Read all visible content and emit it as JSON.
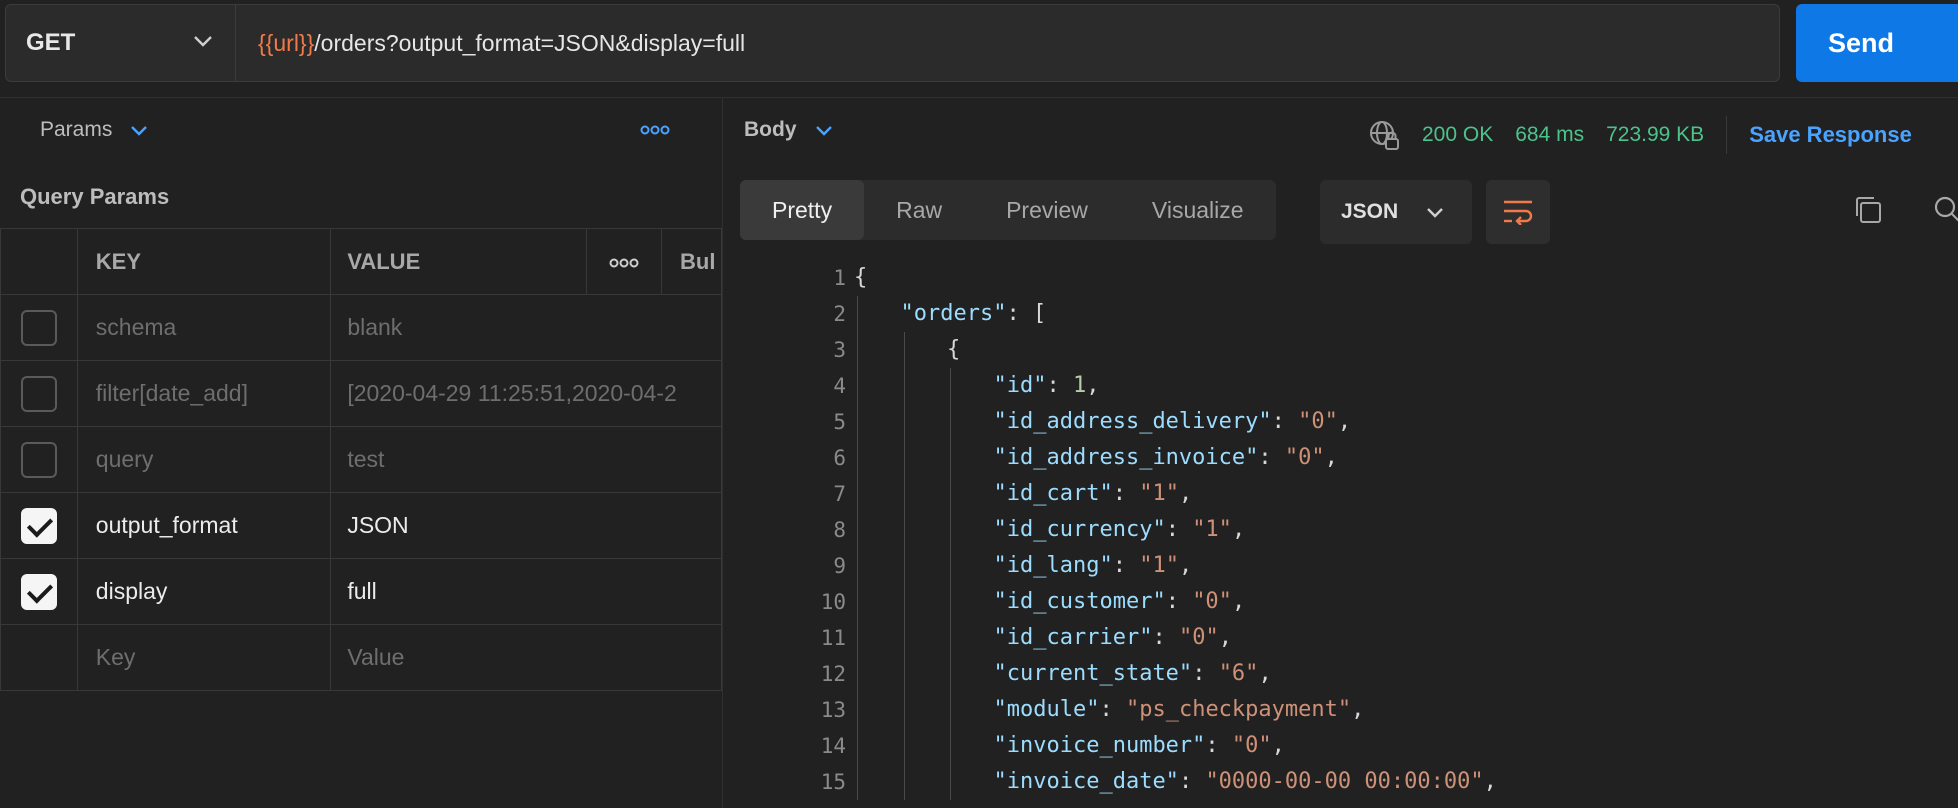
{
  "request": {
    "method": "GET",
    "url_var": "{{url}}",
    "url_path": "/orders?output_format=JSON&display=full",
    "send_label": "Send"
  },
  "params_panel": {
    "tab_label": "Params",
    "section_title": "Query Params",
    "columns": {
      "key": "KEY",
      "value": "VALUE",
      "bulk": "Bul"
    },
    "rows": [
      {
        "checked": false,
        "key": "schema",
        "value": "blank"
      },
      {
        "checked": false,
        "key": "filter[date_add]",
        "value": "[2020-04-29 11:25:51,2020-04-2"
      },
      {
        "checked": false,
        "key": "query",
        "value": "test"
      },
      {
        "checked": true,
        "key": "output_format",
        "value": "JSON"
      },
      {
        "checked": true,
        "key": "display",
        "value": "full"
      }
    ],
    "new_row": {
      "key_placeholder": "Key",
      "value_placeholder": "Value"
    }
  },
  "response": {
    "tab_label": "Body",
    "status": "200 OK",
    "time": "684 ms",
    "size": "723.99 KB",
    "save_label": "Save Response",
    "view_tabs": [
      "Pretty",
      "Raw",
      "Preview",
      "Visualize"
    ],
    "active_view": "Pretty",
    "format": "JSON",
    "lines": [
      {
        "n": "1",
        "indent": 0,
        "parts": [
          [
            "p",
            "{"
          ]
        ]
      },
      {
        "n": "2",
        "indent": 1,
        "parts": [
          [
            "k",
            "\"orders\""
          ],
          [
            "p",
            ": ["
          ]
        ]
      },
      {
        "n": "3",
        "indent": 2,
        "parts": [
          [
            "p",
            "{"
          ]
        ]
      },
      {
        "n": "4",
        "indent": 3,
        "parts": [
          [
            "k",
            "\"id\""
          ],
          [
            "p",
            ": "
          ],
          [
            "n",
            "1"
          ],
          [
            "p",
            ","
          ]
        ]
      },
      {
        "n": "5",
        "indent": 3,
        "parts": [
          [
            "k",
            "\"id_address_delivery\""
          ],
          [
            "p",
            ": "
          ],
          [
            "s",
            "\"0\""
          ],
          [
            "p",
            ","
          ]
        ]
      },
      {
        "n": "6",
        "indent": 3,
        "parts": [
          [
            "k",
            "\"id_address_invoice\""
          ],
          [
            "p",
            ": "
          ],
          [
            "s",
            "\"0\""
          ],
          [
            "p",
            ","
          ]
        ]
      },
      {
        "n": "7",
        "indent": 3,
        "parts": [
          [
            "k",
            "\"id_cart\""
          ],
          [
            "p",
            ": "
          ],
          [
            "s",
            "\"1\""
          ],
          [
            "p",
            ","
          ]
        ]
      },
      {
        "n": "8",
        "indent": 3,
        "parts": [
          [
            "k",
            "\"id_currency\""
          ],
          [
            "p",
            ": "
          ],
          [
            "s",
            "\"1\""
          ],
          [
            "p",
            ","
          ]
        ]
      },
      {
        "n": "9",
        "indent": 3,
        "parts": [
          [
            "k",
            "\"id_lang\""
          ],
          [
            "p",
            ": "
          ],
          [
            "s",
            "\"1\""
          ],
          [
            "p",
            ","
          ]
        ]
      },
      {
        "n": "10",
        "indent": 3,
        "parts": [
          [
            "k",
            "\"id_customer\""
          ],
          [
            "p",
            ": "
          ],
          [
            "s",
            "\"0\""
          ],
          [
            "p",
            ","
          ]
        ]
      },
      {
        "n": "11",
        "indent": 3,
        "parts": [
          [
            "k",
            "\"id_carrier\""
          ],
          [
            "p",
            ": "
          ],
          [
            "s",
            "\"0\""
          ],
          [
            "p",
            ","
          ]
        ]
      },
      {
        "n": "12",
        "indent": 3,
        "parts": [
          [
            "k",
            "\"current_state\""
          ],
          [
            "p",
            ": "
          ],
          [
            "s",
            "\"6\""
          ],
          [
            "p",
            ","
          ]
        ]
      },
      {
        "n": "13",
        "indent": 3,
        "parts": [
          [
            "k",
            "\"module\""
          ],
          [
            "p",
            ": "
          ],
          [
            "s",
            "\"ps_checkpayment\""
          ],
          [
            "p",
            ","
          ]
        ]
      },
      {
        "n": "14",
        "indent": 3,
        "parts": [
          [
            "k",
            "\"invoice_number\""
          ],
          [
            "p",
            ": "
          ],
          [
            "s",
            "\"0\""
          ],
          [
            "p",
            ","
          ]
        ]
      },
      {
        "n": "15",
        "indent": 3,
        "parts": [
          [
            "k",
            "\"invoice_date\""
          ],
          [
            "p",
            ": "
          ],
          [
            "s",
            "\"0000-00-00 00:00:00\""
          ],
          [
            "p",
            ","
          ]
        ]
      }
    ]
  },
  "icons": {
    "method_dropdown": "chevron-down-icon",
    "send_dropdown": "chevron-down-icon",
    "params_more": "more-horizontal-icon",
    "globe": "globe-lock-icon",
    "wrap": "wrap-lines-icon",
    "copy": "copy-icon",
    "search": "search-icon"
  },
  "colors": {
    "accent": "#0d78e6",
    "status_ok": "#4cc38a",
    "url_variable": "#f27a4a",
    "link": "#4aa3ff"
  }
}
